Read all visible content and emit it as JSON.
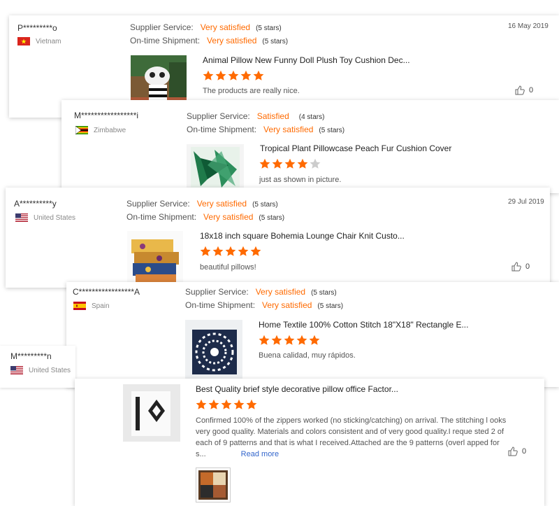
{
  "reviews": [
    {
      "name": "P*********o",
      "country": "Vietnam",
      "supplier_label": "Supplier Service:",
      "supplier_value": "Very satisfied",
      "supplier_count": "(5 stars)",
      "shipment_label": "On-time Shipment:",
      "shipment_value": "Very satisfied",
      "shipment_count": "(5 stars)",
      "date": "16 May 2019",
      "product": "Animal Pillow New Funny Doll Plush Toy Cushion Dec...",
      "rating": 5,
      "text": "The products are really nice.",
      "likes": "0"
    },
    {
      "name": "M*****************i",
      "country": "Zimbabwe",
      "supplier_label": "Supplier Service:",
      "supplier_value": "Satisfied",
      "supplier_count": "(4 stars)",
      "shipment_label": "On-time Shipment:",
      "shipment_value": "Very satisfied",
      "shipment_count": "(5 stars)",
      "product": "Tropical Plant Pillowcase Peach Fur Cushion Cover",
      "rating": 4,
      "text": "just as shown in picture."
    },
    {
      "name": "A**********y",
      "country": "United States",
      "supplier_label": "Supplier Service:",
      "supplier_value": "Very satisfied",
      "supplier_count": "(5 stars)",
      "shipment_label": "On-time Shipment:",
      "shipment_value": "Very satisfied",
      "shipment_count": "(5 stars)",
      "date": "29 Jul 2019",
      "product": "18x18 inch square Bohemia Lounge Chair Knit Custo...",
      "rating": 5,
      "text": "beautiful pillows!",
      "likes": "0"
    },
    {
      "name": "C*****************A",
      "country": "Spain",
      "supplier_label": "Supplier Service:",
      "supplier_value": "Very satisfied",
      "supplier_count": "(5 stars)",
      "shipment_label": "On-time Shipment:",
      "shipment_value": "Very satisfied",
      "shipment_count": "(5 stars)",
      "product": "Home Textile 100% Cotton Stitch 18\"X18\" Rectangle E...",
      "rating": 5,
      "text": "Buena calidad, muy rápidos."
    },
    {
      "name": "M*********n",
      "country": "United States",
      "product": "Best Quality brief style decorative pillow office Factor...",
      "rating": 5,
      "text": "Confirmed 100% of the zippers worked (no sticking/catching) on arrival.   The stitching l ooks very good quality.  Materials and colors consistent and of very good quality.I reque sted 2 of each of 9 patterns and that is what I received.Attached are the 9 patterns (overl apped for s...",
      "read_more": "Read more",
      "likes": "0"
    }
  ],
  "colors": {
    "accent": "#ff6a00",
    "star_off": "#cccccc",
    "link": "#3366cc"
  }
}
